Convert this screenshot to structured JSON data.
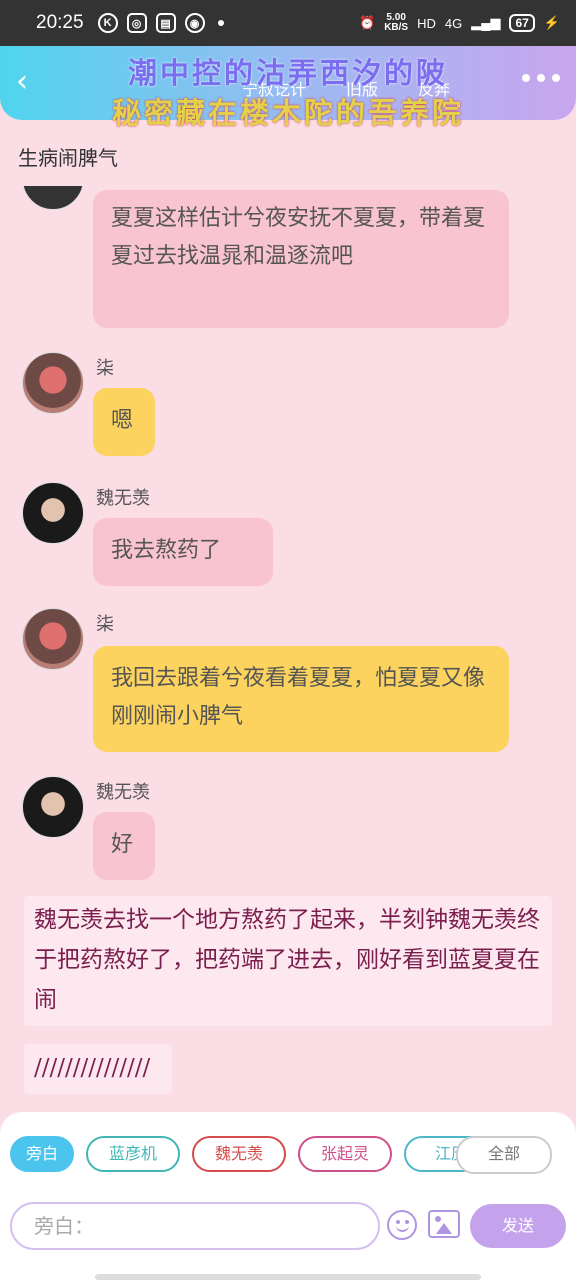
{
  "status_bar": {
    "time": "20:25",
    "speed_value": "5.00",
    "speed_unit": "KB/S",
    "hd": "HD",
    "network": "4G",
    "battery": "67"
  },
  "header": {
    "title_line1": "潮中控的沽弄西汐的陂",
    "title_line2": "秘密藏在楼木陀的吾养院",
    "menu": [
      "宁叔讫计",
      "旧版",
      "反奔"
    ]
  },
  "chat_title": "生病闹脾气",
  "messages": [
    {
      "sender": "",
      "text": "夏夏这样估计兮夜安抚不夏夏，带着夏夏过去找温晁和温逐流吧"
    },
    {
      "sender": "柒",
      "text": "嗯"
    },
    {
      "sender": "魏无羡",
      "text": "我去熬药了"
    },
    {
      "sender": "柒",
      "text": "我回去跟着兮夜看着夏夏，怕夏夏又像刚刚闹小脾气"
    },
    {
      "sender": "魏无羡",
      "text": "好"
    }
  ],
  "narrations": [
    "魏无羡去找一个地方熬药了起来，半刻钟魏无羡终于把药熬好了，把药端了进去，刚好看到蓝夏夏在闹",
    "///////////////"
  ],
  "roles": [
    "旁白",
    "蓝彦机",
    "魏无羡",
    "张起灵",
    "江厌"
  ],
  "all_label": "全部",
  "input": {
    "placeholder": "旁白："
  },
  "send_label": "发送"
}
